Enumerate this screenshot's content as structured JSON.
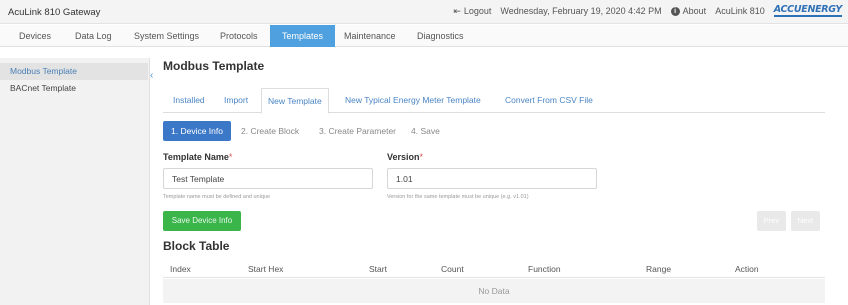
{
  "app_title": "AcuLink 810 Gateway",
  "topbar": {
    "logout_label": "Logout",
    "datetime": "Wednesday, February 19, 2020 4:42 PM",
    "about_label": "About",
    "device_name": "AcuLink 810",
    "logo_text": "ACCUENERGY"
  },
  "nav": {
    "items": [
      "Devices",
      "Data Log",
      "System Settings",
      "Protocols",
      "Templates",
      "Maintenance",
      "Diagnostics"
    ],
    "active": "Templates"
  },
  "sidebar": {
    "items": [
      "Modbus Template",
      "BACnet Template"
    ],
    "active": "Modbus Template"
  },
  "main": {
    "title": "Modbus Template",
    "tabs": [
      "Installed",
      "Import",
      "New Template",
      "New Typical Energy Meter Template",
      "Convert From CSV File"
    ],
    "active_tab": "New Template",
    "steps": [
      "1. Device Info",
      "2. Create Block",
      "3. Create Parameter",
      "4. Save"
    ],
    "active_step": "1. Device Info",
    "form": {
      "template_name": {
        "label": "Template Name",
        "required_mark": "*",
        "value": "Test Template",
        "hint": "Template name must be defined and unique"
      },
      "version": {
        "label": "Version",
        "required_mark": "*",
        "value": "1.01",
        "hint": "Version for the same template must be unique (e.g. v1.01)"
      }
    },
    "save_button": "Save Device Info",
    "prev_button": "Prev",
    "next_button": "Next",
    "block_table": {
      "title": "Block Table",
      "columns": [
        "Index",
        "Start Hex",
        "Start",
        "Count",
        "Function",
        "Range",
        "Action"
      ],
      "empty_text": "No Data"
    }
  },
  "colors": {
    "accent": "#4fa0de",
    "primary": "#3c78c8",
    "success": "#39b54a",
    "link": "#4a85c5",
    "required": "#d9534f"
  }
}
